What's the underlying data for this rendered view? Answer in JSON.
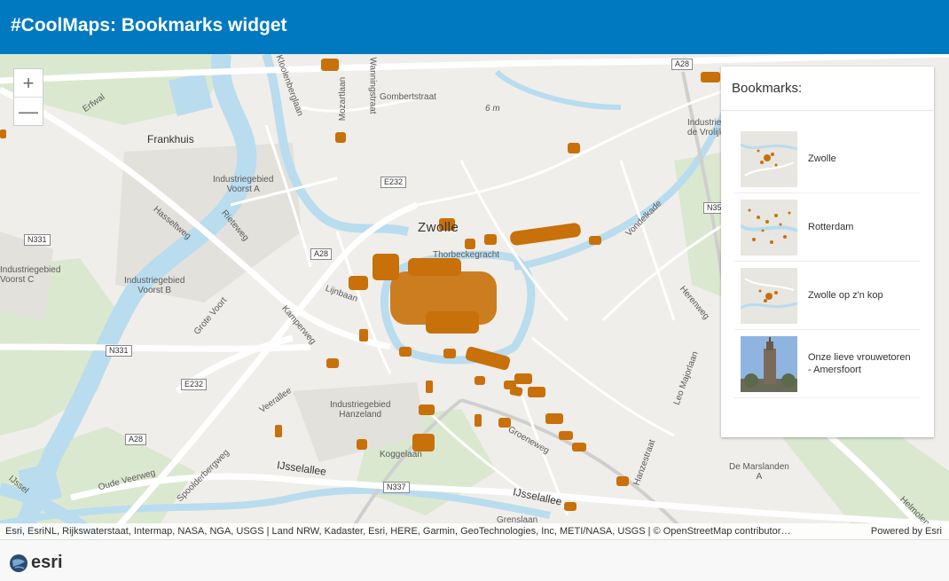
{
  "header": {
    "title": "#CoolMaps: Bookmarks widget"
  },
  "zoom": {
    "in_label": "+",
    "out_label": "—"
  },
  "map": {
    "labels": {
      "zwolle": "Zwolle",
      "frankhuis": "Frankhuis",
      "voorst_a": "Industriegebied\nVoorst A",
      "voorst_b": "Industriegebied\nVoorst B",
      "voorst_c": "Industriegebied\nVoorst C",
      "hanzeland": "Industriegebied\nHanzeland",
      "de_vrolijkheid": "Industriegebied\nde Vrolijkheid",
      "de_marslanden": "De Marslanden\nA",
      "erfwal": "Erfwal",
      "gombertstraat": "Gombertstraat",
      "klooienberglaan": "Kloolenberglaan",
      "mozartlaan": "Mozartlaan",
      "wanningstraat": "Wanningstraat",
      "hasseltweg": "Hasseltweg",
      "rieteweg": "Rieteweg",
      "lijnbaan": "Lijnbaan",
      "grote_voort": "Grote Voort",
      "kamperweg": "Kamperweg",
      "veerallee": "Veerallee",
      "oude_veerweg": "Oude Veerweg",
      "spoolderbergweg": "Spoolderbergweg",
      "ijsselallee": "IJsselallee",
      "ijsselallee2": "IJsselallee",
      "ijssel": "IJssel",
      "koggelaan": "Koggelaan",
      "groeneweg": "Groeneweg",
      "vondelkade": "Vondelkade",
      "herenweg": "Herenweg",
      "leo_majorlaan": "Leo Majorlaan",
      "hanzestraat": "Hanzestraat",
      "thorbeckegracht": "Thorbeckegracht",
      "grenslaan": "Grenslaan",
      "helmolen": "Helmolen",
      "six_m": "6 m"
    },
    "shields": {
      "a28_top": "A28",
      "a28_mid": "A28",
      "a28_bot": "A28",
      "e232_top": "E232",
      "e232_bot": "E232",
      "n331_left": "N331",
      "n331_mid": "N331",
      "n337": "N337",
      "n35": "N35"
    }
  },
  "bookmarks": {
    "title": "Bookmarks:",
    "items": [
      {
        "name": "Zwolle"
      },
      {
        "name": "Rotterdam"
      },
      {
        "name": "Zwolle op z'n kop"
      },
      {
        "name": "Onze lieve vrouwetoren - Amersfoort"
      }
    ]
  },
  "attribution": {
    "left": "Esri, EsriNL, Rijkswaterstaat, Intermap, NASA, NGA, USGS | Land NRW, Kadaster, Esri, HERE, Garmin, GeoTechnologies, Inc, METI/NASA, USGS | © OpenStreetMap contributor…",
    "right": "Powered by Esri"
  },
  "footer": {
    "logo_text": "esri"
  },
  "colors": {
    "header": "#0079c1",
    "poi": "#c8700a",
    "water": "#b9dcef",
    "park": "#dbe8d0"
  }
}
